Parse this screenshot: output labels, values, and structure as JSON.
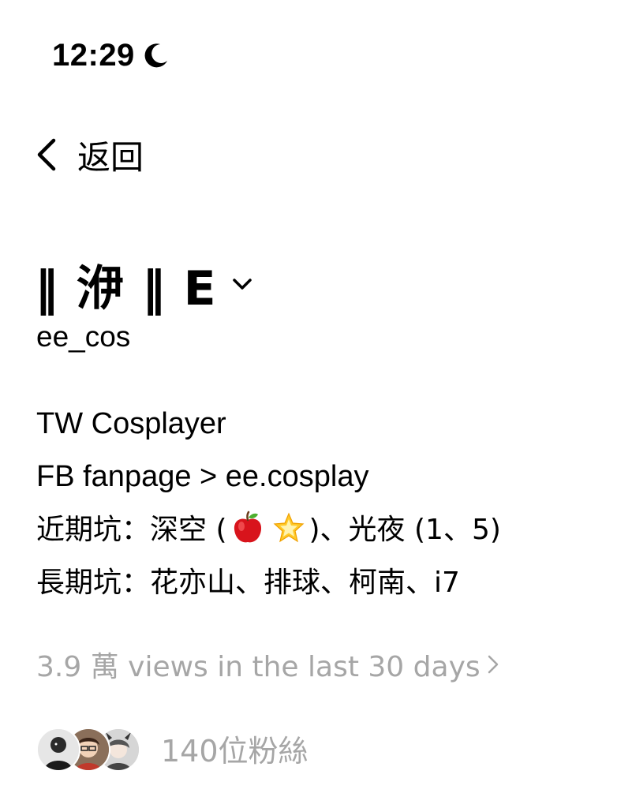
{
  "status_bar": {
    "time": "12:29",
    "focus_icon": "moon-icon"
  },
  "nav": {
    "back_label": "返回",
    "back_icon": "chevron-left-icon"
  },
  "profile": {
    "display_name": "‖ 洢 ‖ E",
    "username": "ee_cos",
    "switch_icon": "chevron-down-icon",
    "bio": {
      "line1": "TW Cosplayer",
      "line2": "FB fanpage > ee.cosplay",
      "line3_prefix": "近期坑：深空 (",
      "line3_emoji_1": "red-apple-emoji",
      "line3_emoji_2": "glowing-star-emoji",
      "line3_suffix": ")、光夜 (1、5)",
      "line4": "長期坑：花亦山、排球、柯南、i7"
    },
    "insights": {
      "views_text": "3.9 萬 views in the last 30 days",
      "arrow_icon": "chevron-right-icon"
    },
    "followers": {
      "text": "140位粉絲",
      "avatar_count": 3
    }
  },
  "colors": {
    "text_primary": "#000000",
    "text_secondary": "#a6a6a6",
    "background": "#ffffff"
  }
}
